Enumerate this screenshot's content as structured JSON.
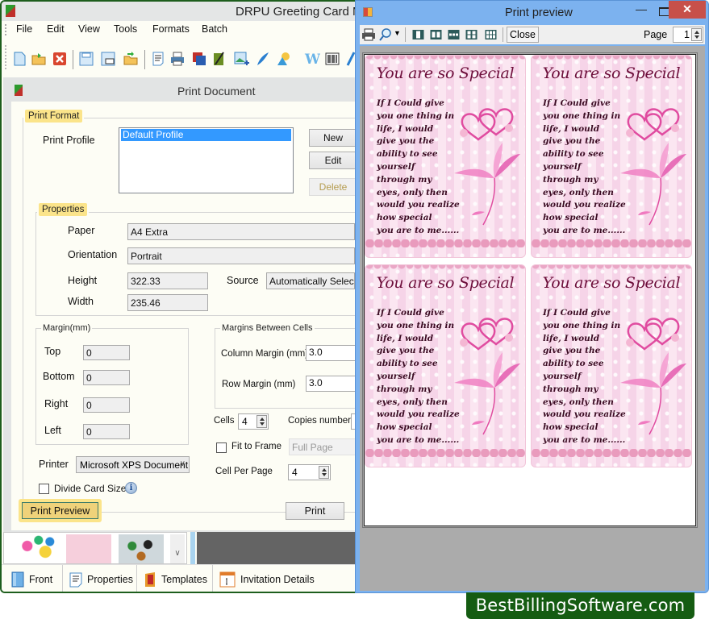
{
  "app": {
    "title": "DRPU Greeting Card M",
    "menu": [
      "File",
      "Edit",
      "View",
      "Tools",
      "Formats",
      "Batch"
    ],
    "toolbar_icons": [
      "new-document-icon",
      "open-folder-icon",
      "close-icon",
      "save-icon",
      "save-as-icon",
      "import-folder-icon",
      "properties-icon",
      "print-icon",
      "layers-icon",
      "card-design-icon",
      "insert-image-icon",
      "pen-icon",
      "shapes-icon",
      "wordart-icon",
      "barcode-icon",
      "text-icon"
    ]
  },
  "print_document": {
    "title": "Print Document",
    "print_format": {
      "legend": "Print Format",
      "profile_label": "Print Profile",
      "profiles": [
        "Default Profile"
      ],
      "selected_profile": "Default Profile",
      "buttons": {
        "new": "New",
        "edit": "Edit",
        "delete": "Delete"
      }
    },
    "properties": {
      "legend": "Properties",
      "paper_label": "Paper",
      "paper_value": "A4 Extra",
      "orientation_label": "Orientation",
      "orientation_value": "Portrait",
      "height_label": "Height",
      "height_value": "322.33",
      "width_label": "Width",
      "width_value": "235.46",
      "source_label": "Source",
      "source_value": "Automatically Selec"
    },
    "margin": {
      "legend": "Margin(mm)",
      "top_label": "Top",
      "top_value": "0",
      "bottom_label": "Bottom",
      "bottom_value": "0",
      "right_label": "Right",
      "right_value": "0",
      "left_label": "Left",
      "left_value": "0"
    },
    "cell_margins": {
      "legend": "Margins Between Cells",
      "column_label": "Column Margin (mm)",
      "column_value": "3.0",
      "row_label": "Row Margin (mm)",
      "row_value": "3.0"
    },
    "cells_label": "Cells",
    "cells_value": "4",
    "copies_label": "Copies number",
    "fit_to_frame_label": "Fit to Frame",
    "fit_to_frame_checked": false,
    "fit_mode_value": "Full Page",
    "cell_per_page_label": "Cell Per Page",
    "cell_per_page_value": "4",
    "printer_label": "Printer",
    "printer_value": "Microsoft XPS Document",
    "divide_card_label": "Divide Card Size",
    "divide_card_checked": false,
    "print_preview_button": "Print Preview",
    "print_button": "Print"
  },
  "bottom_tabs": [
    {
      "label": "Front",
      "icon": "front-page-icon"
    },
    {
      "label": "Properties",
      "icon": "properties-icon"
    },
    {
      "label": "Templates",
      "icon": "templates-icon"
    },
    {
      "label": "Invitation Details",
      "icon": "invitation-details-icon"
    }
  ],
  "preview": {
    "title": "Print preview",
    "close_button": "Close",
    "page_label": "Page",
    "page_value": "1",
    "cards": [
      {
        "title": "You are so Special",
        "poem": "If I Could give\nyou one thing in\nlife, I would\ngive you the\nability to see\nyourself\nthrough my\neyes, only then\nwould you realize\nhow special\nyou are to me......"
      },
      {
        "title": "You are so Special",
        "poem": "If I Could give\nyou one thing in\nlife, I would\ngive you the\nability to see\nyourself\nthrough my\neyes, only then\nwould you realize\nhow special\nyou are to me......"
      },
      {
        "title": "You are so Special",
        "poem": "If I Could give\nyou one thing in\nlife, I would\ngive you the\nability to see\nyourself\nthrough my\neyes, only then\nwould you realize\nhow special\nyou are to me......"
      },
      {
        "title": "You are so Special",
        "poem": "If I Could give\nyou one thing in\nlife, I would\ngive you the\nability to see\nyourself\nthrough my\neyes, only then\nwould you realize\nhow special\nyou are to me......"
      }
    ]
  },
  "watermark": "BestBillingSoftware.com"
}
